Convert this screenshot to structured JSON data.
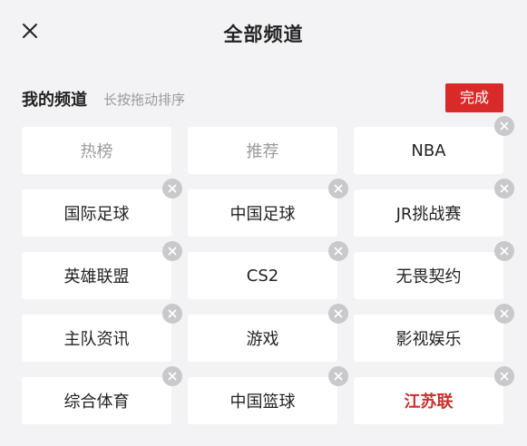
{
  "header": {
    "title": "全部频道",
    "close_icon": "close-icon"
  },
  "section": {
    "title": "我的频道",
    "hint": "长按拖动排序",
    "done_label": "完成",
    "accent_color": "#d92a2a"
  },
  "channels": [
    {
      "label": "热榜",
      "fixed": true,
      "removable": false
    },
    {
      "label": "推荐",
      "fixed": true,
      "removable": false
    },
    {
      "label": "NBA",
      "fixed": false,
      "removable": true
    },
    {
      "label": "国际足球",
      "fixed": false,
      "removable": true
    },
    {
      "label": "中国足球",
      "fixed": false,
      "removable": true
    },
    {
      "label": "JR挑战赛",
      "fixed": false,
      "removable": true
    },
    {
      "label": "英雄联盟",
      "fixed": false,
      "removable": true
    },
    {
      "label": "CS2",
      "fixed": false,
      "removable": true
    },
    {
      "label": "无畏契约",
      "fixed": false,
      "removable": true
    },
    {
      "label": "主队资讯",
      "fixed": false,
      "removable": true
    },
    {
      "label": "游戏",
      "fixed": false,
      "removable": true
    },
    {
      "label": "影视娱乐",
      "fixed": false,
      "removable": true
    },
    {
      "label": "综合体育",
      "fixed": false,
      "removable": true
    },
    {
      "label": "中国篮球",
      "fixed": false,
      "removable": true
    },
    {
      "label": "江苏联",
      "fixed": false,
      "removable": true,
      "highlight": true
    }
  ]
}
